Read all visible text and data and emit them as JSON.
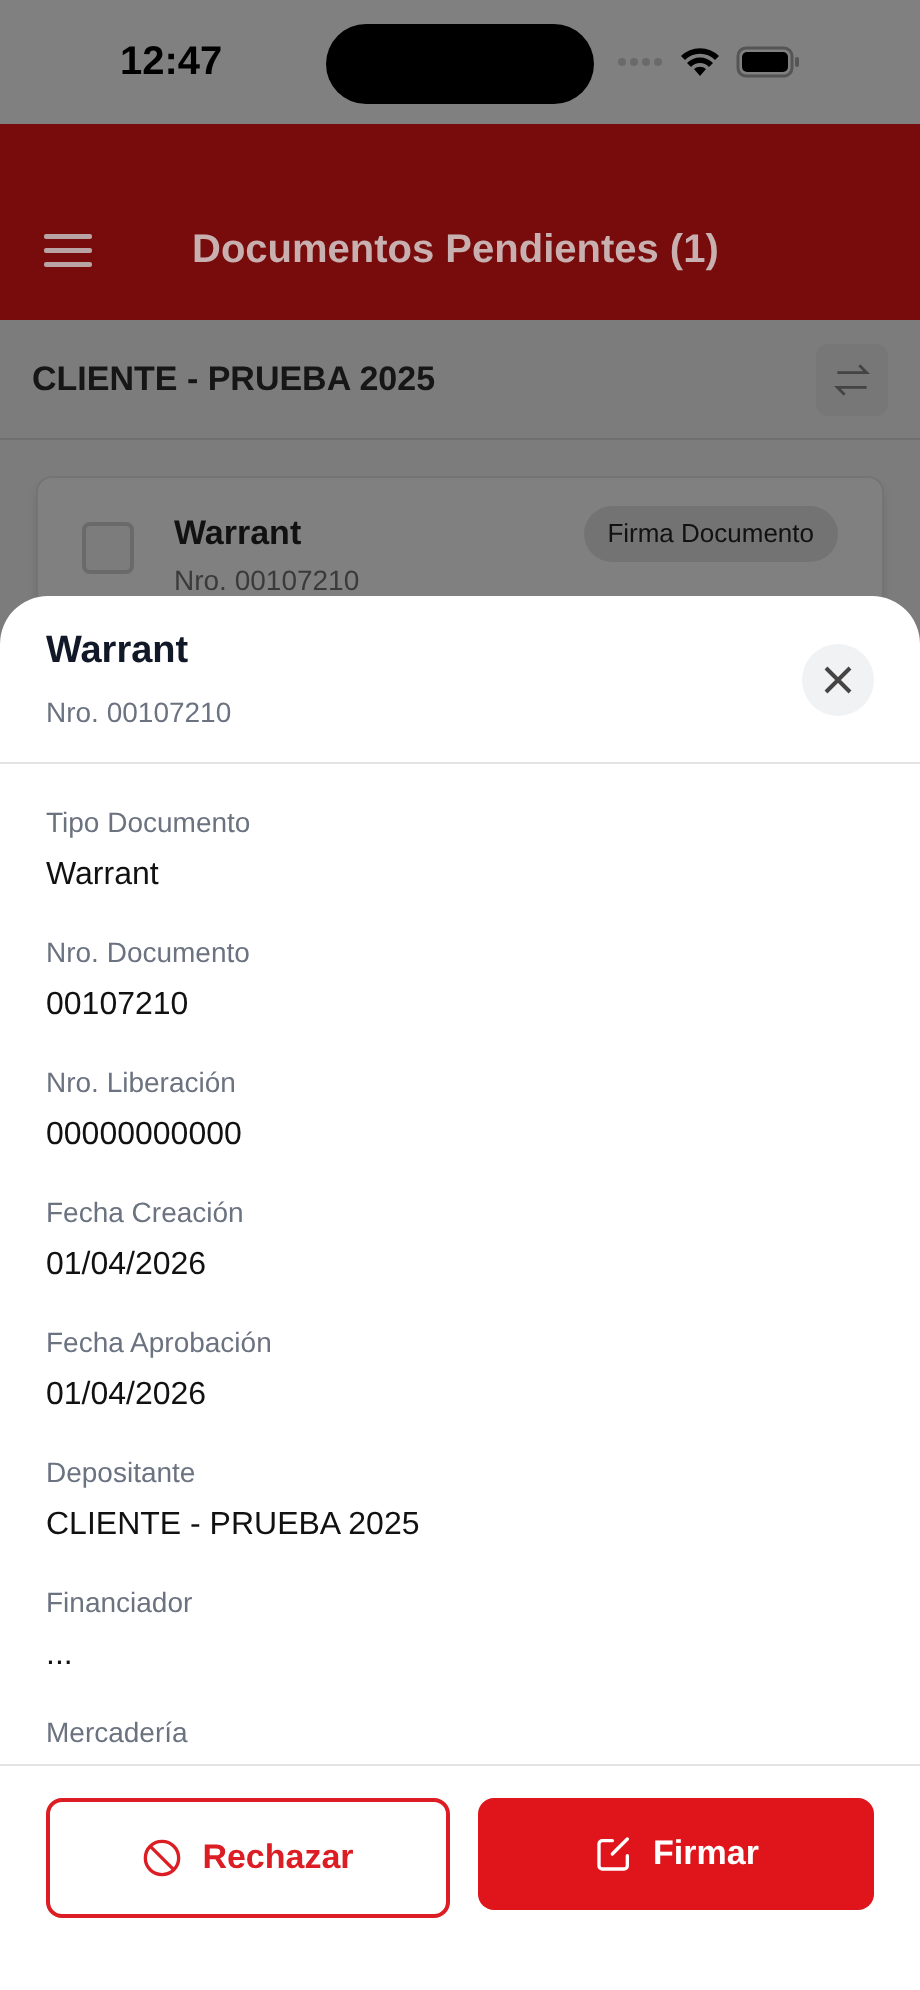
{
  "status_bar": {
    "time": "12:47"
  },
  "header": {
    "title": "Documentos Pendientes (1)"
  },
  "client": {
    "name": "CLIENTE - PRUEBA 2025"
  },
  "card": {
    "title": "Warrant",
    "number": "Nro. 00107210",
    "badge": "Firma Documento",
    "checked": false
  },
  "sheet": {
    "title": "Warrant",
    "subtitle": "Nro. 00107210",
    "fields": [
      {
        "label": "Tipo Documento",
        "value": "Warrant"
      },
      {
        "label": "Nro. Documento",
        "value": "00107210"
      },
      {
        "label": "Nro. Liberación",
        "value": "00000000000"
      },
      {
        "label": "Fecha Creación",
        "value": "01/04/2026"
      },
      {
        "label": "Fecha Aprobación",
        "value": "01/04/2026"
      },
      {
        "label": "Depositante",
        "value": "CLIENTE - PRUEBA 2025"
      },
      {
        "label": "Financiador",
        "value": "..."
      },
      {
        "label": "Mercadería"
      }
    ]
  },
  "buttons": [
    {
      "label": "Rechazar",
      "kind": "reject"
    },
    {
      "label": "Firmar",
      "kind": "sign"
    }
  ]
}
